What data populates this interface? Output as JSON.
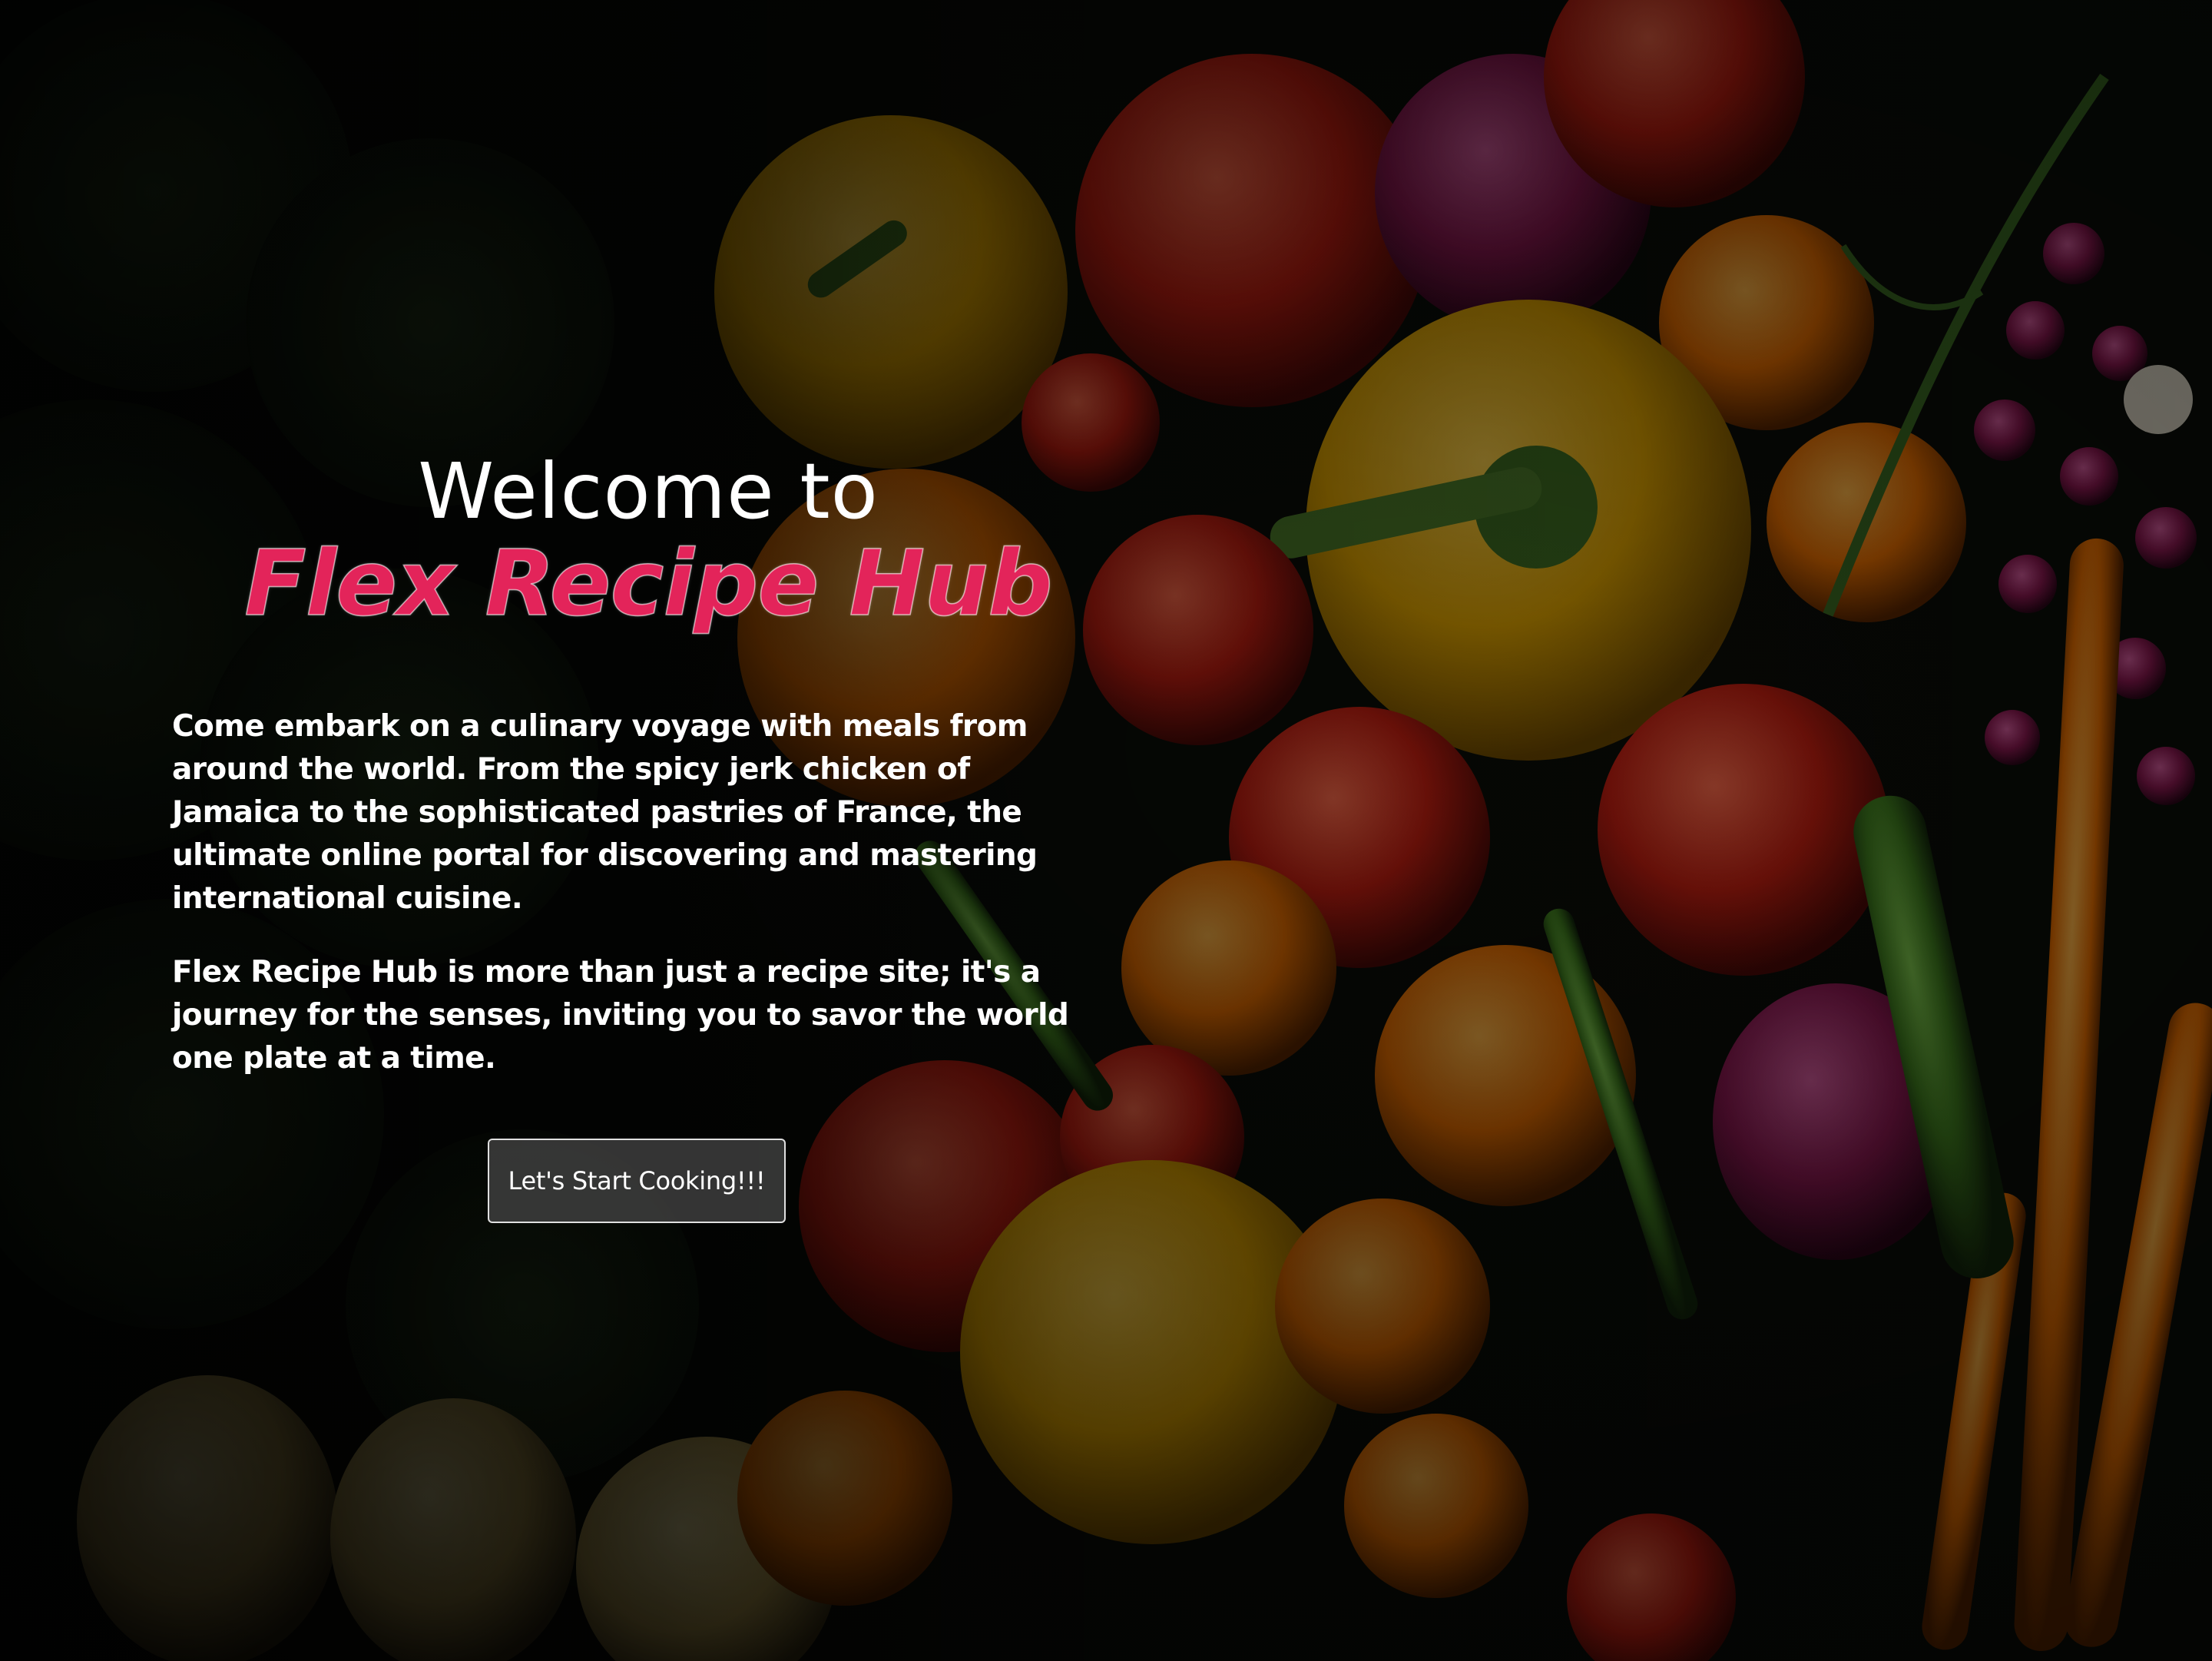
{
  "hero": {
    "welcome": "Welcome to",
    "brand": "Flex Recipe Hub",
    "paragraph_1": "Come embark on a culinary voyage with meals from around the world. From the spicy jerk chicken of Jamaica to the sophisticated pastries of France, the ultimate online portal for discovering and mastering international cuisine.",
    "paragraph_2": "Flex Recipe Hub is more than just a recipe site; it's a journey for the senses, inviting you to savor the world one plate at a time.",
    "cta_label": "Let's Start Cooking!!!"
  },
  "colors": {
    "brand_accent": "#e3245a",
    "text": "#ffffff",
    "overlay": "#000000"
  }
}
